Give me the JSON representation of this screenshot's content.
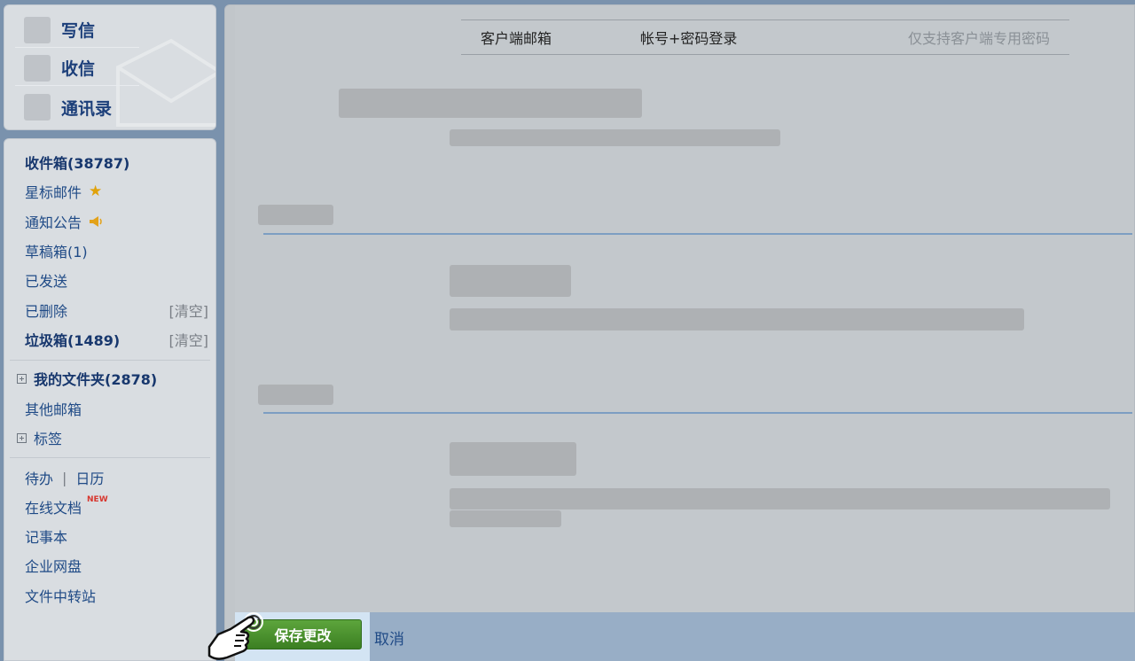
{
  "top_nav": {
    "compose": "写信",
    "receive": "收信",
    "contacts": "通讯录"
  },
  "folders": {
    "inbox": "收件箱(38787)",
    "starred": "星标邮件",
    "notices": "通知公告",
    "drafts": "草稿箱(1)",
    "sent": "已发送",
    "deleted": "已删除",
    "deleted_clear": "[清空]",
    "spam": "垃圾箱(1489)",
    "spam_clear": "[清空]",
    "my_folders": "我的文件夹(2878)",
    "other_mailboxes": "其他邮箱",
    "tags": "标签",
    "todo": "待办",
    "divider": "|",
    "calendar": "日历",
    "online_docs": "在线文档",
    "online_docs_badge": "NEW",
    "notebook": "记事本",
    "enterprise_disk": "企业网盘",
    "file_transfer": "文件中转站"
  },
  "client_table": {
    "col1": "客户端邮箱",
    "col2": "帐号+密码登录",
    "col3": "仅支持客户端专用密码"
  },
  "actions": {
    "save": "保存更改",
    "cancel": "取消"
  },
  "colors": {
    "accent_blue": "#1f4a86",
    "save_green": "#4a9530",
    "new_badge": "#d7372f",
    "star": "#e0a20b"
  }
}
